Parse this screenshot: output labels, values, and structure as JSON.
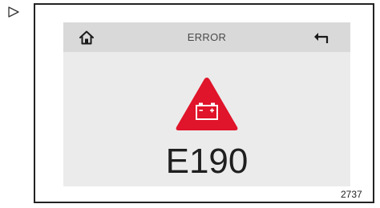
{
  "screen": {
    "title": "ERROR",
    "error_code": "E190",
    "icons": {
      "home": "home-icon",
      "back": "back-arrow-icon",
      "warning": "battery-warning-icon",
      "bullet": "triangle-bullet-icon"
    },
    "colors": {
      "warning": "#e0142a",
      "header": "#d9d9d9",
      "screen": "#ebebeb"
    }
  },
  "figure": {
    "reference_number": "2737"
  }
}
